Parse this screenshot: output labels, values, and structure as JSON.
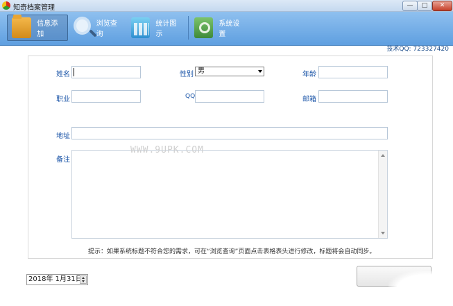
{
  "window": {
    "title": "知奇档案管理",
    "min_label": "—",
    "max_label": "□",
    "close_label": "✕"
  },
  "toolbar": {
    "items": [
      {
        "label": "信息添加",
        "icon": "folder-icon",
        "active": true
      },
      {
        "label": "浏览查询",
        "icon": "magnifier-icon",
        "active": false
      },
      {
        "label": "统计图示",
        "icon": "chart-icon",
        "active": false
      },
      {
        "label": "系统设置",
        "icon": "gear-icon",
        "active": false
      }
    ],
    "support": "技术QQ: 723327420"
  },
  "form": {
    "name_label": "姓名",
    "name_value": "",
    "gender_label": "性别",
    "gender_value": "男",
    "age_label": "年龄",
    "age_value": "",
    "job_label": "职业",
    "job_value": "",
    "qq_label": "QQ",
    "qq_value": "",
    "email_label": "邮箱",
    "email_value": "",
    "address_label": "地址",
    "address_value": "",
    "note_label": "备注",
    "note_value": ""
  },
  "hint": "提示：如果系统标题不符合您的需求，可在“浏览查询”页面点击表格表头进行修改，标题将会自动同步。",
  "watermark": "WWW.9UPK.COM",
  "date": {
    "value": "2018年  1月31日"
  },
  "save_button": {
    "label": ""
  },
  "colors": {
    "toolbar_top": "#8fc0ef",
    "toolbar_bottom": "#5f9fe0",
    "label_blue": "#1b55a8"
  }
}
